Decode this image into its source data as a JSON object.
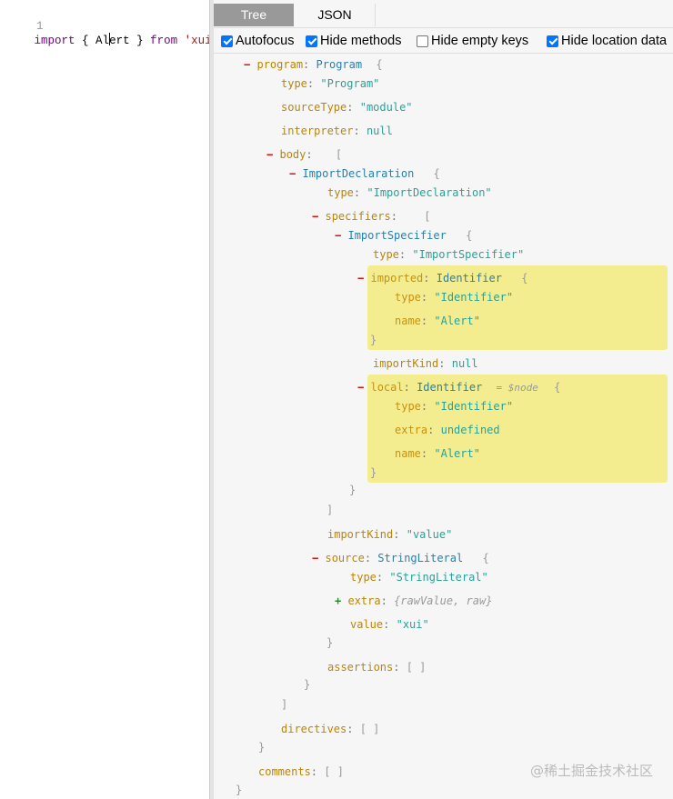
{
  "editor": {
    "line_number": "1",
    "kw_import": "import",
    "brace_open": " { Al",
    "brace_rest": "ert } ",
    "kw_from": "from",
    "string": " 'xui'"
  },
  "tabs": [
    {
      "label": "Tree",
      "active": true
    },
    {
      "label": "JSON",
      "active": false
    }
  ],
  "options": [
    {
      "label": "Autofocus",
      "checked": true
    },
    {
      "label": "Hide methods",
      "checked": true
    },
    {
      "label": "Hide empty keys",
      "checked": false
    },
    {
      "label": "Hide location data",
      "checked": true
    }
  ],
  "tree": {
    "program_key": "program",
    "program_type": "Program",
    "type_key": "type",
    "program_type_val": "\"Program\"",
    "sourceType_key": "sourceType",
    "sourceType_val": "\"module\"",
    "interpreter_key": "interpreter",
    "null_val": "null",
    "body_key": "body",
    "importdecl_type": "ImportDeclaration",
    "importdecl_type_val": "\"ImportDeclaration\"",
    "specifiers_key": "specifiers",
    "importspec_type": "ImportSpecifier",
    "importspec_type_val": "\"ImportSpecifier\"",
    "imported_key": "imported",
    "identifier_type": "Identifier",
    "identifier_type_val": "\"Identifier\"",
    "name_key": "name",
    "alert_val": "\"Alert\"",
    "importKind_key": "importKind",
    "local_key": "local",
    "node_ann": "= $node",
    "extra_key": "extra",
    "undefined_val": "undefined",
    "importKind_val": "\"value\"",
    "source_key": "source",
    "stringliteral_type": "StringLiteral",
    "stringliteral_type_val": "\"StringLiteral\"",
    "extra_summary": "{rawValue, raw}",
    "value_key": "value",
    "xui_val": "\"xui\"",
    "assertions_key": "assertions",
    "directives_key": "directives",
    "comments_key": "comments",
    "empty_array": "[ ]",
    "minus": "−",
    "plus": "+",
    "open_obj": "{",
    "close_obj": "}",
    "open_arr": "[",
    "close_arr": "]",
    "colon": ":"
  },
  "watermark": "@稀土掘金技术社区",
  "colors": {
    "highlight": "#f3ed8f",
    "active_tab": "#999999",
    "checkbox": "#0075ff"
  }
}
